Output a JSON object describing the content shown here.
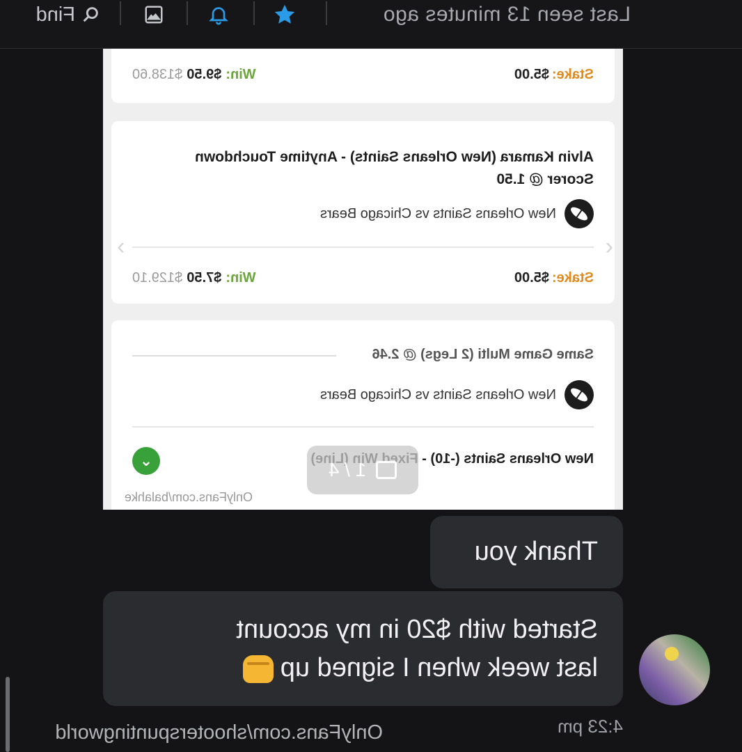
{
  "header": {
    "status": "Last seen 13 minutes ago",
    "search_label": "Find",
    "icons": [
      "star-icon",
      "bell-icon",
      "image-icon",
      "search-icon"
    ],
    "accent": "#2a9be8"
  },
  "screenshot": {
    "card1": {
      "stake_label": "Stake:",
      "stake_value": "$5.00",
      "win_label": "Win:",
      "win_value": "$9.50",
      "win_old": "$138.60"
    },
    "card2": {
      "title": "Alvin Kamara (New Orleans Saints) - Anytime Touchdown Scorer @ 1.50",
      "match": "New Orleans Saints vs Chicago Bears",
      "stake_label": "Stake:",
      "stake_value": "$5.00",
      "win_label": "Win:",
      "win_value": "$7.50",
      "win_old": "$129.10"
    },
    "card3": {
      "multi": "Same Game Multi (2 Legs) @ 2.46",
      "match": "New Orleans Saints vs Chicago Bears",
      "leg": "New Orleans Saints (-10) - Fixed Win (Line)"
    },
    "pager": "1 / 4",
    "watermark": "OnlyFans.com/balahke"
  },
  "messages": [
    {
      "text": "Thank you"
    },
    {
      "text_line1": "Started with $20 in my account",
      "text_line2": "last week when I signed up"
    }
  ],
  "time": "4:23 pm",
  "watermark": "OnlyFans.com/shooterspuntingworld"
}
